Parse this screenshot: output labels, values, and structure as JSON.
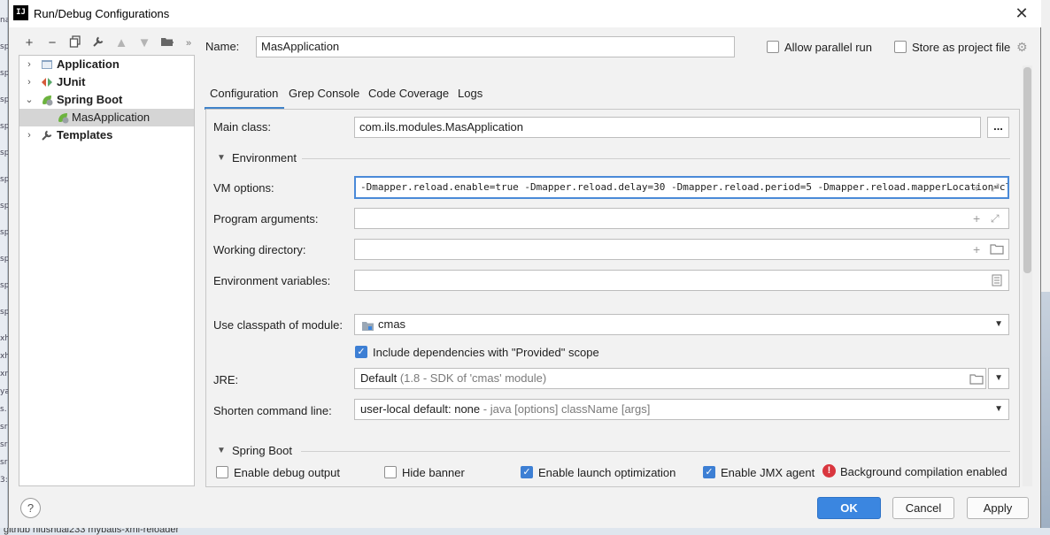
{
  "window": {
    "title": "Run/Debug Configurations",
    "app_icon": "IJ",
    "close_glyph": "✕"
  },
  "toolbar": {
    "icons": [
      "plus-icon",
      "minus-icon",
      "copy-icon",
      "wrench-icon",
      "arrow-up-icon",
      "arrow-down-icon",
      "folder-move-icon",
      "more-icon"
    ]
  },
  "tree": {
    "items": [
      {
        "label": "Application",
        "bold": true,
        "level": 0,
        "expanded": false,
        "icon": "application-icon"
      },
      {
        "label": "JUnit",
        "bold": true,
        "level": 0,
        "expanded": false,
        "icon": "junit-icon"
      },
      {
        "label": "Spring Boot",
        "bold": true,
        "level": 0,
        "expanded": true,
        "icon": "spring-boot-icon"
      },
      {
        "label": "MasApplication",
        "bold": false,
        "level": 1,
        "selected": true,
        "icon": "spring-boot-icon"
      },
      {
        "label": "Templates",
        "bold": true,
        "level": 0,
        "expanded": false,
        "icon": "wrench-icon"
      }
    ]
  },
  "header": {
    "name_label": "Name:",
    "name_value": "MasApplication",
    "allow_parallel_label": "Allow parallel run",
    "store_project_label": "Store as project file"
  },
  "tabs": [
    {
      "label": "Configuration",
      "active": true
    },
    {
      "label": "Grep Console",
      "active": false
    },
    {
      "label": "Code Coverage",
      "active": false
    },
    {
      "label": "Logs",
      "active": false
    }
  ],
  "config": {
    "main_class_label": "Main class:",
    "main_class_value": "com.ils.modules.MasApplication",
    "browse_label": "...",
    "environment_section": "Environment",
    "vm_options_label": "VM options:",
    "vm_options_value": "-Dmapper.reload.enable=true -Dmapper.reload.delay=30 -Dmapper.reload.period=5 -Dmapper.reload.mapperLocation=classp",
    "program_args_label": "Program arguments:",
    "working_dir_label": "Working directory:",
    "env_vars_label": "Environment variables:",
    "classpath_label": "Use classpath of module:",
    "classpath_value": "cmas",
    "include_deps_label": "Include dependencies with \"Provided\" scope",
    "jre_label": "JRE:",
    "jre_value": "Default",
    "jre_hint": "(1.8 - SDK of 'cmas' module)",
    "shorten_label": "Shorten command line:",
    "shorten_value": "user-local default: none",
    "shorten_hint": "- java [options] className [args]",
    "spring_section": "Spring Boot",
    "debug_output_label": "Enable debug output",
    "hide_banner_label": "Hide banner",
    "launch_opt_label": "Enable launch optimization",
    "jmx_label": "Enable JMX agent",
    "bg_compile_label": "Background compilation enabled"
  },
  "buttons": {
    "ok": "OK",
    "cancel": "Cancel",
    "apply": "Apply",
    "help": "?"
  },
  "desktop": {
    "bottom_text": "github niushuai233 mybatis-xml-reloader"
  },
  "colors": {
    "accent": "#3b86e0",
    "tab_underline": "#4083c9",
    "error": "#d9363e"
  }
}
